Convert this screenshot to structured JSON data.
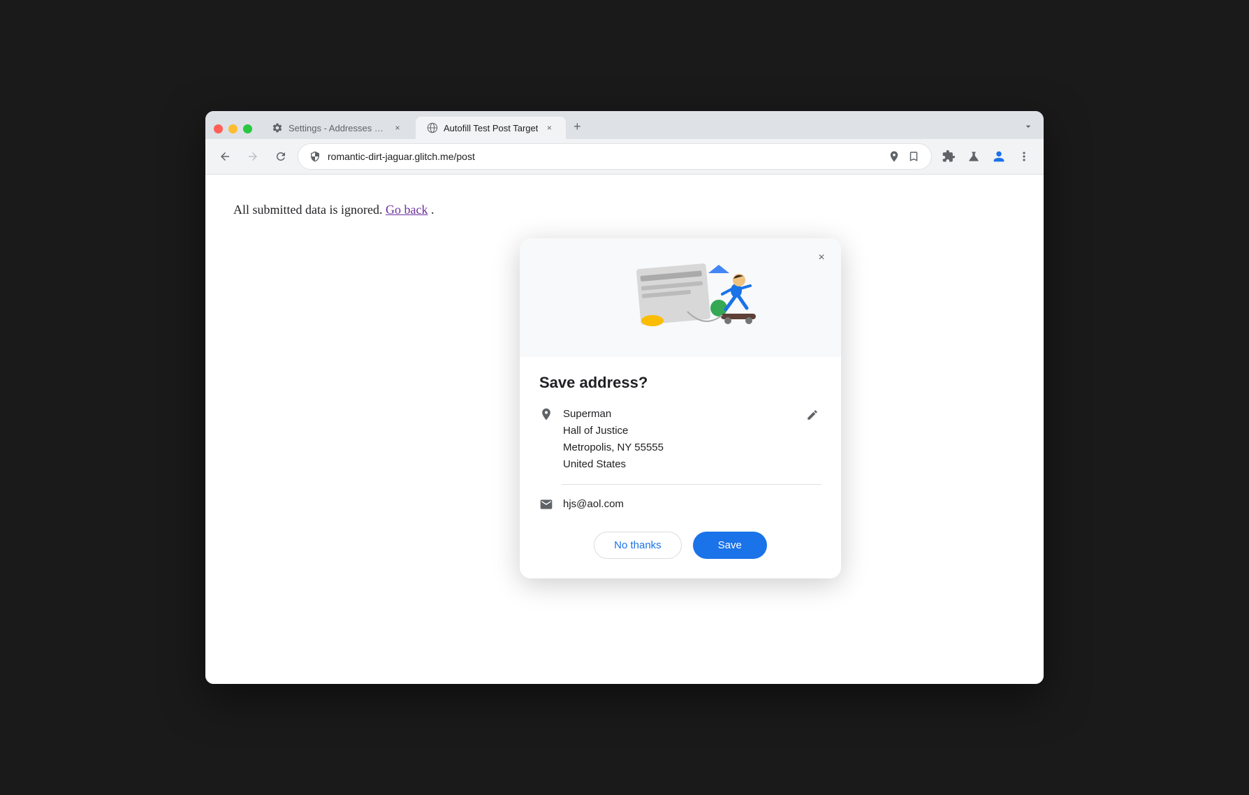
{
  "browser": {
    "tabs": [
      {
        "id": "settings-tab",
        "icon": "gear",
        "title": "Settings - Addresses and mo",
        "active": false
      },
      {
        "id": "autofill-tab",
        "icon": "globe",
        "title": "Autofill Test Post Target",
        "active": true
      }
    ],
    "new_tab_label": "+",
    "dropdown_label": "▾",
    "nav": {
      "back_label": "←",
      "forward_label": "→",
      "refresh_label": "↻",
      "url": "romantic-dirt-jaguar.glitch.me/post"
    }
  },
  "page": {
    "text": "All submitted data is ignored.",
    "link_text": "Go back",
    "period": "."
  },
  "dialog": {
    "title": "Save address?",
    "close_label": "×",
    "address": {
      "name": "Superman",
      "line1": "Hall of Justice",
      "line2": "Metropolis, NY 55555",
      "line3": "United States"
    },
    "email": "hjs@aol.com",
    "buttons": {
      "no_thanks": "No thanks",
      "save": "Save"
    }
  },
  "icons": {
    "location": "📍",
    "email": "✉",
    "edit": "✏",
    "close": "×",
    "gear": "⚙",
    "globe": "🌐",
    "location_pin": "📍",
    "star": "☆",
    "puzzle": "🧩",
    "flask": "⚗",
    "person": "👤",
    "menu": "⋮",
    "shield": "🛡"
  }
}
